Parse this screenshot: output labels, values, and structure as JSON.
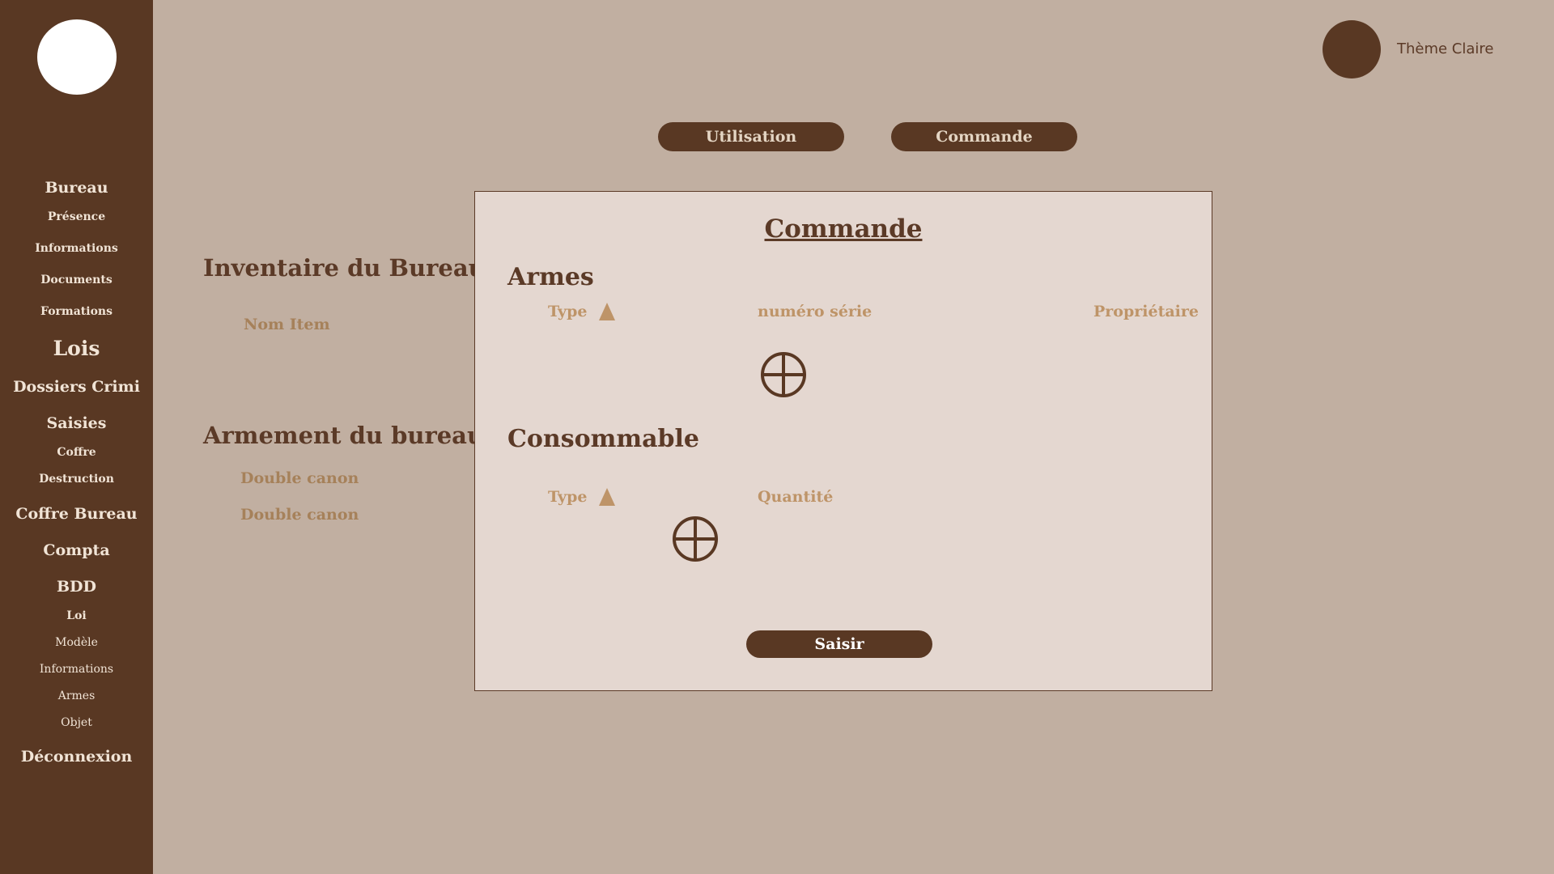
{
  "sidebar": {
    "items": [
      {
        "label": "Bureau"
      },
      {
        "label": "Présence"
      },
      {
        "label": "Informations"
      },
      {
        "label": "Documents"
      },
      {
        "label": "Formations"
      },
      {
        "label": "Lois"
      },
      {
        "label": "Dossiers Crimi"
      },
      {
        "label": "Saisies"
      },
      {
        "label": "Coffre"
      },
      {
        "label": "Destruction"
      },
      {
        "label": "Coffre Bureau"
      },
      {
        "label": "Compta"
      },
      {
        "label": "BDD"
      },
      {
        "label": "Loi"
      },
      {
        "label": "Modèle"
      },
      {
        "label": "Informations"
      },
      {
        "label": "Armes"
      },
      {
        "label": "Objet"
      },
      {
        "label": "Déconnexion"
      }
    ]
  },
  "header": {
    "theme_label": "Thème Claire",
    "tabs": [
      {
        "label": "Utilisation"
      },
      {
        "label": "Commande"
      }
    ]
  },
  "main": {
    "inventory_title": "Inventaire du Bureau",
    "inventory_col": "Nom Item",
    "armament_title": "Armement du bureau",
    "armament_items": [
      "Double canon",
      "Double canon"
    ]
  },
  "modal": {
    "title": "Commande",
    "weapons_title": "Armes",
    "weapons_cols": [
      "Type",
      "numéro série",
      "Propriétaire"
    ],
    "consumable_title": "Consommable",
    "consumable_cols": [
      "Type",
      "Quantité"
    ],
    "submit_label": "Saisir"
  },
  "colors": {
    "background": "#c1afa1",
    "sidebar": "#593823",
    "modal": "#e4d7d0",
    "accent_text": "#be9468"
  }
}
